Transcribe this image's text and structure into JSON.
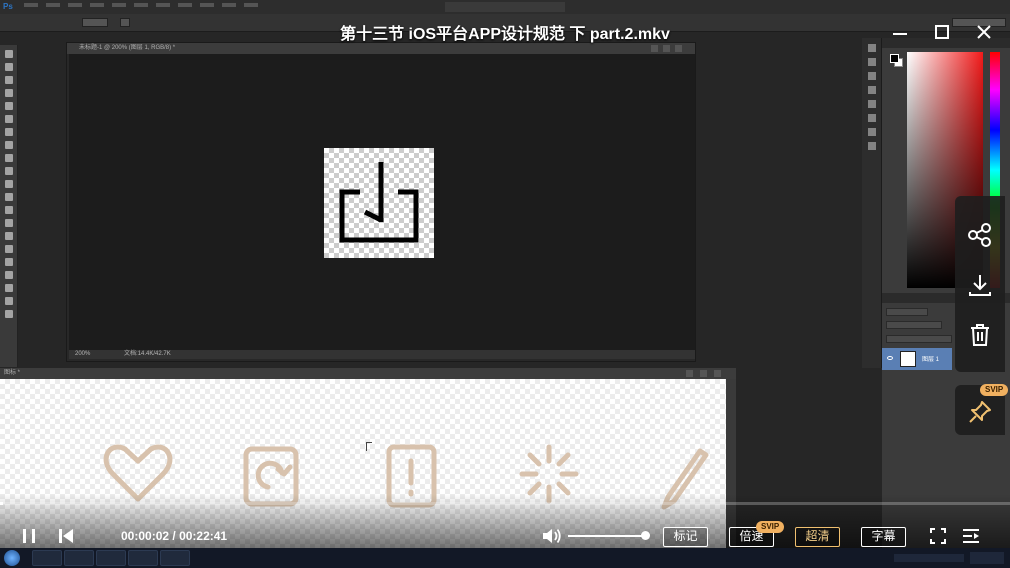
{
  "player": {
    "title": "第十三节 iOS平台APP设计规范 下 part.2.mkv",
    "time_current": "00:00:02",
    "time_separator": " / ",
    "time_total": "00:22:41",
    "progress_fraction": 0.0015,
    "volume_fraction": 1.0,
    "buttons": {
      "mark": "标记",
      "speed": "倍速",
      "quality": "超清",
      "subtitle": "字幕"
    },
    "badges": {
      "speed_badge": "SVIP",
      "pin_badge": "SVIP"
    },
    "side_actions": [
      "share-icon",
      "download-icon",
      "delete-icon"
    ],
    "colors": {
      "gold": "#f0c070",
      "text": "#ffffff"
    }
  },
  "photoshop": {
    "app_logo": "Ps",
    "doc1_title": "未标题-1 @ 200% (图层 1, RGB/8) *",
    "doc1_zoom": "200%",
    "doc1_status": "文档:14.4K/42.7K",
    "doc2_title": "图标 *",
    "layer_name": "图层 1",
    "icon_color": "#c9a98c"
  }
}
